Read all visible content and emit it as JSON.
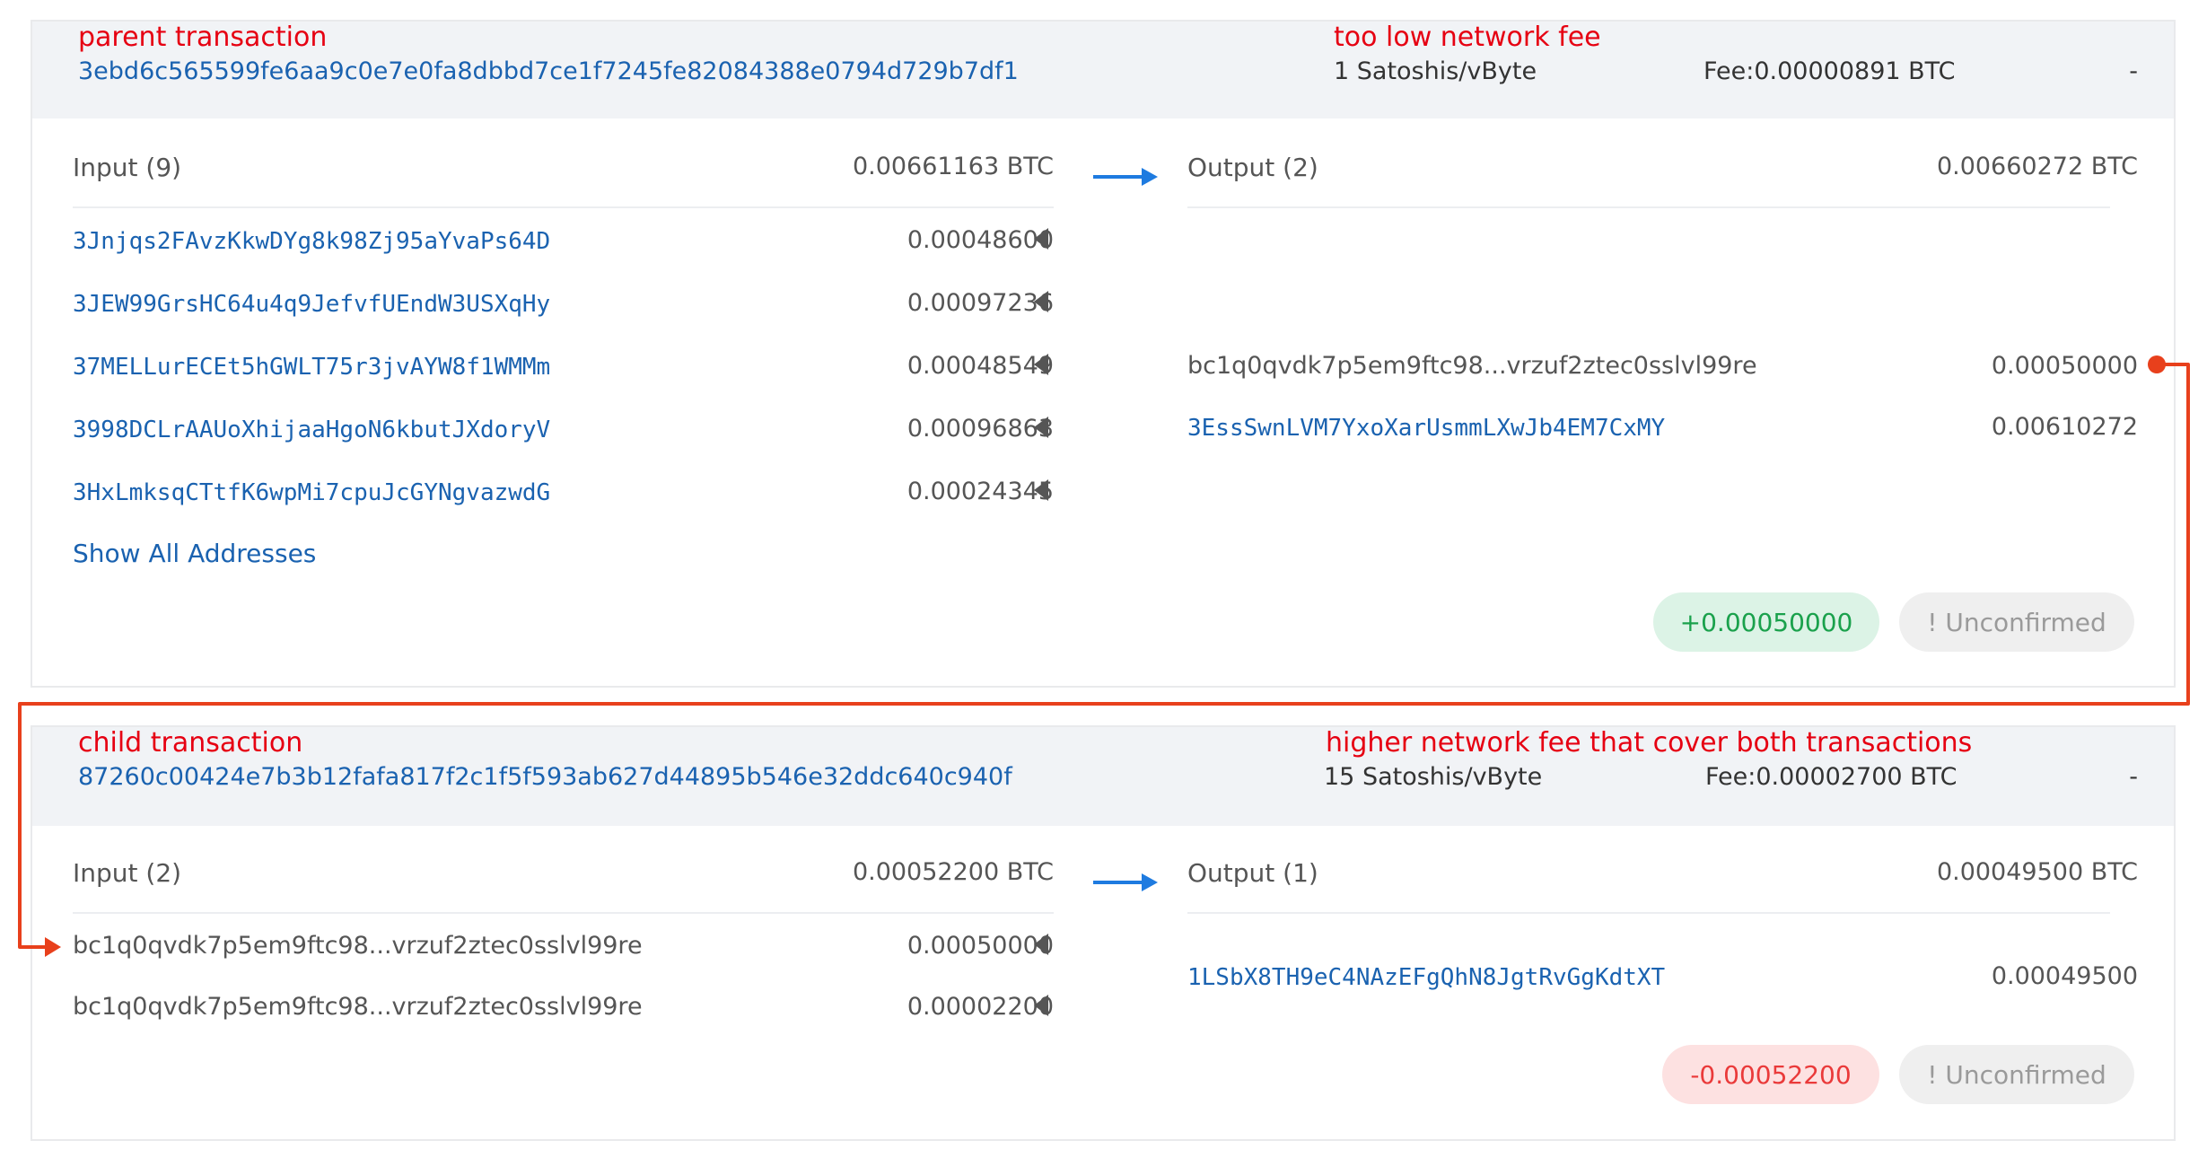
{
  "colors": {
    "annotation": "#e60012",
    "link": "#1a62b0",
    "arrow_blue": "#1e7be0",
    "arrow_red": "#e8401c",
    "positive": "#1aa14c",
    "negative": "#ea3a3a"
  },
  "parent": {
    "annotation_left": "parent transaction",
    "annotation_right": "too low network fee",
    "txid": "3ebd6c565599fe6aa9c0e7e0fa8dbbd7ce1f7245fe82084388e0794d729b7df1",
    "fee_rate": "1 Satoshis/vByte",
    "fee": "Fee:0.00000891 BTC",
    "dash": "-",
    "input_label": "Input (9)",
    "input_total": "0.00661163 BTC",
    "output_label": "Output (2)",
    "output_total": "0.00660272 BTC",
    "inputs": [
      {
        "address": "3Jnjqs2FAvzKkwDYg8k98Zj95aYvaPs64D",
        "amount": "0.00048600"
      },
      {
        "address": "3JEW99GrsHC64u4q9JefvfUEndW3USXqHy",
        "amount": "0.00097236"
      },
      {
        "address": "37MELLurECEt5hGWLT75r3jvAYW8f1WMMm",
        "amount": "0.00048549"
      },
      {
        "address": "3998DCLrAAUoXhijaaHgoN6kbutJXdoryV",
        "amount": "0.00096863"
      },
      {
        "address": "3HxLmksqCTtfK6wpMi7cpuJcGYNgvazwdG",
        "amount": "0.00024345"
      }
    ],
    "outputs": [
      {
        "address": "bc1q0qvdk7p5em9ftc98...vrzuf2ztec0sslvl99re",
        "amount": "0.00050000"
      },
      {
        "address": "3EssSwnLVM7YxoXarUsmmLXwJb4EM7CxMY",
        "amount": "0.00610272"
      }
    ],
    "show_all": "Show All Addresses",
    "net_amount": "+0.00050000",
    "status": "! Unconfirmed"
  },
  "child": {
    "annotation_left": "child transaction",
    "annotation_right": "higher network fee that cover both transactions",
    "txid": "87260c00424e7b3b12fafa817f2c1f5f593ab627d44895b546e32ddc640c940f",
    "fee_rate": "15 Satoshis/vByte",
    "fee": "Fee:0.00002700 BTC",
    "dash": "-",
    "input_label": "Input (2)",
    "input_total": "0.00052200 BTC",
    "output_label": "Output (1)",
    "output_total": "0.00049500 BTC",
    "inputs": [
      {
        "address": "bc1q0qvdk7p5em9ftc98...vrzuf2ztec0sslvl99re",
        "amount": "0.00050000"
      },
      {
        "address": "bc1q0qvdk7p5em9ftc98...vrzuf2ztec0sslvl99re",
        "amount": "0.00002200"
      }
    ],
    "outputs": [
      {
        "address": "1LSbX8TH9eC4NAzEFgQhN8JgtRvGgKdtXT",
        "amount": "0.00049500"
      }
    ],
    "net_amount": "-0.00052200",
    "status": "! Unconfirmed"
  }
}
